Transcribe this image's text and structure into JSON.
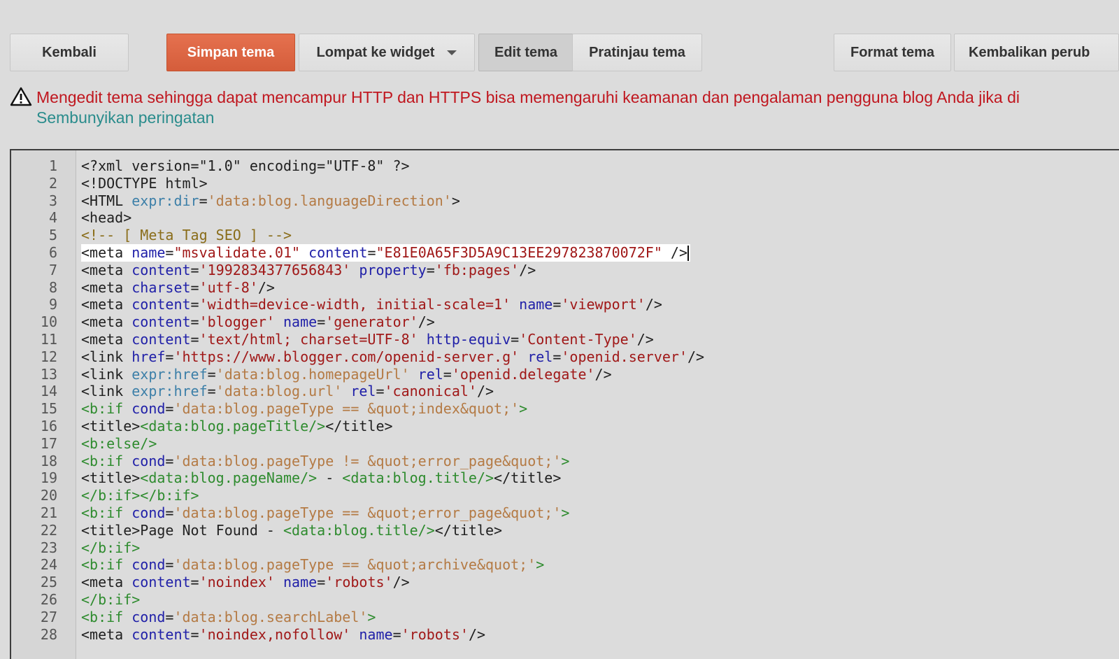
{
  "toolbar": {
    "back_label": "Kembali",
    "save_label": "Simpan tema",
    "jump_label": "Lompat ke widget",
    "edit_label": "Edit tema",
    "preview_label": "Pratinjau tema",
    "format_label": "Format tema",
    "revert_label": "Kembalikan perub"
  },
  "warning": {
    "text": "Mengedit tema sehingga dapat mencampur HTTP dan HTTPS bisa memengaruhi keamanan dan pengalaman pengguna blog Anda jika di",
    "hide_link": "Sembunyikan peringatan"
  },
  "colors": {
    "save_button": "#d55d3b",
    "warning_text": "#c0171f",
    "link": "#2a8c8c",
    "background": "#dcdcdc"
  },
  "editor": {
    "active_line": 6,
    "lines": [
      [
        [
          "tag",
          "<?xml version=\"1.0\" encoding=\"UTF-8\" ?>"
        ]
      ],
      [
        [
          "tag",
          "<!DOCTYPE html>"
        ]
      ],
      [
        [
          "tag",
          "<HTML "
        ],
        [
          "attrx",
          "expr:dir"
        ],
        [
          "tag",
          "="
        ],
        [
          "valx",
          "'data:blog.languageDirection'"
        ],
        [
          "tag",
          ">"
        ]
      ],
      [
        [
          "tag",
          "<head>"
        ]
      ],
      [
        [
          "comment",
          "<!-- [ Meta Tag SEO ] -->"
        ]
      ],
      [
        [
          "tag",
          "<meta "
        ],
        [
          "attr",
          "name"
        ],
        [
          "tag",
          "="
        ],
        [
          "val",
          "\"msvalidate.01\""
        ],
        [
          "tag",
          " "
        ],
        [
          "attr",
          "content"
        ],
        [
          "tag",
          "="
        ],
        [
          "val",
          "\"E81E0A65F3D5A9C13EE297823870072F\""
        ],
        [
          "tag",
          " />"
        ]
      ],
      [
        [
          "tag",
          "<meta "
        ],
        [
          "attr",
          "content"
        ],
        [
          "tag",
          "="
        ],
        [
          "val",
          "'1992834377656843'"
        ],
        [
          "tag",
          " "
        ],
        [
          "attr",
          "property"
        ],
        [
          "tag",
          "="
        ],
        [
          "val",
          "'fb:pages'"
        ],
        [
          "tag",
          "/>"
        ]
      ],
      [
        [
          "tag",
          "<meta "
        ],
        [
          "attr",
          "charset"
        ],
        [
          "tag",
          "="
        ],
        [
          "val",
          "'utf-8'"
        ],
        [
          "tag",
          "/>"
        ]
      ],
      [
        [
          "tag",
          "<meta "
        ],
        [
          "attr",
          "content"
        ],
        [
          "tag",
          "="
        ],
        [
          "val",
          "'width=device-width, initial-scale=1'"
        ],
        [
          "tag",
          " "
        ],
        [
          "attr",
          "name"
        ],
        [
          "tag",
          "="
        ],
        [
          "val",
          "'viewport'"
        ],
        [
          "tag",
          "/>"
        ]
      ],
      [
        [
          "tag",
          "<meta "
        ],
        [
          "attr",
          "content"
        ],
        [
          "tag",
          "="
        ],
        [
          "val",
          "'blogger'"
        ],
        [
          "tag",
          " "
        ],
        [
          "attr",
          "name"
        ],
        [
          "tag",
          "="
        ],
        [
          "val",
          "'generator'"
        ],
        [
          "tag",
          "/>"
        ]
      ],
      [
        [
          "tag",
          "<meta "
        ],
        [
          "attr",
          "content"
        ],
        [
          "tag",
          "="
        ],
        [
          "val",
          "'text/html; charset=UTF-8'"
        ],
        [
          "tag",
          " "
        ],
        [
          "attr",
          "http-equiv"
        ],
        [
          "tag",
          "="
        ],
        [
          "val",
          "'Content-Type'"
        ],
        [
          "tag",
          "/>"
        ]
      ],
      [
        [
          "tag",
          "<link "
        ],
        [
          "attr",
          "href"
        ],
        [
          "tag",
          "="
        ],
        [
          "val",
          "'https://www.blogger.com/openid-server.g'"
        ],
        [
          "tag",
          " "
        ],
        [
          "attr",
          "rel"
        ],
        [
          "tag",
          "="
        ],
        [
          "val",
          "'openid.server'"
        ],
        [
          "tag",
          "/>"
        ]
      ],
      [
        [
          "tag",
          "<link "
        ],
        [
          "attrx",
          "expr:href"
        ],
        [
          "tag",
          "="
        ],
        [
          "valx",
          "'data:blog.homepageUrl'"
        ],
        [
          "tag",
          " "
        ],
        [
          "attr",
          "rel"
        ],
        [
          "tag",
          "="
        ],
        [
          "val",
          "'openid.delegate'"
        ],
        [
          "tag",
          "/>"
        ]
      ],
      [
        [
          "tag",
          "<link "
        ],
        [
          "attrx",
          "expr:href"
        ],
        [
          "tag",
          "="
        ],
        [
          "valx",
          "'data:blog.url'"
        ],
        [
          "tag",
          " "
        ],
        [
          "attr",
          "rel"
        ],
        [
          "tag",
          "="
        ],
        [
          "val",
          "'canonical'"
        ],
        [
          "tag",
          "/>"
        ]
      ],
      [
        [
          "btag",
          "<b:if "
        ],
        [
          "attr",
          "cond"
        ],
        [
          "tag",
          "="
        ],
        [
          "valx",
          "'data:blog.pageType == &quot;index&quot;'"
        ],
        [
          "btag",
          ">"
        ]
      ],
      [
        [
          "tag",
          "<title>"
        ],
        [
          "btag",
          "<data:blog.pageTitle/>"
        ],
        [
          "tag",
          "</title>"
        ]
      ],
      [
        [
          "btag",
          "<b:else/>"
        ]
      ],
      [
        [
          "btag",
          "<b:if "
        ],
        [
          "attr",
          "cond"
        ],
        [
          "tag",
          "="
        ],
        [
          "valx",
          "'data:blog.pageType != &quot;error_page&quot;'"
        ],
        [
          "btag",
          ">"
        ]
      ],
      [
        [
          "tag",
          "<title>"
        ],
        [
          "btag",
          "<data:blog.pageName/>"
        ],
        [
          "text",
          " - "
        ],
        [
          "btag",
          "<data:blog.title/>"
        ],
        [
          "tag",
          "</title>"
        ]
      ],
      [
        [
          "btag",
          "</b:if></b:if>"
        ]
      ],
      [
        [
          "btag",
          "<b:if "
        ],
        [
          "attr",
          "cond"
        ],
        [
          "tag",
          "="
        ],
        [
          "valx",
          "'data:blog.pageType == &quot;error_page&quot;'"
        ],
        [
          "btag",
          ">"
        ]
      ],
      [
        [
          "tag",
          "<title>"
        ],
        [
          "text",
          "Page Not Found - "
        ],
        [
          "btag",
          "<data:blog.title/>"
        ],
        [
          "tag",
          "</title>"
        ]
      ],
      [
        [
          "btag",
          "</b:if>"
        ]
      ],
      [
        [
          "btag",
          "<b:if "
        ],
        [
          "attr",
          "cond"
        ],
        [
          "tag",
          "="
        ],
        [
          "valx",
          "'data:blog.pageType == &quot;archive&quot;'"
        ],
        [
          "btag",
          ">"
        ]
      ],
      [
        [
          "tag",
          "<meta "
        ],
        [
          "attr",
          "content"
        ],
        [
          "tag",
          "="
        ],
        [
          "val",
          "'noindex'"
        ],
        [
          "tag",
          " "
        ],
        [
          "attr",
          "name"
        ],
        [
          "tag",
          "="
        ],
        [
          "val",
          "'robots'"
        ],
        [
          "tag",
          "/>"
        ]
      ],
      [
        [
          "btag",
          "</b:if>"
        ]
      ],
      [
        [
          "btag",
          "<b:if "
        ],
        [
          "attr",
          "cond"
        ],
        [
          "tag",
          "="
        ],
        [
          "valx",
          "'data:blog.searchLabel'"
        ],
        [
          "btag",
          ">"
        ]
      ],
      [
        [
          "tag",
          "<meta "
        ],
        [
          "attr",
          "content"
        ],
        [
          "tag",
          "="
        ],
        [
          "val",
          "'noindex,nofollow'"
        ],
        [
          "tag",
          " "
        ],
        [
          "attr",
          "name"
        ],
        [
          "tag",
          "="
        ],
        [
          "val",
          "'robots'"
        ],
        [
          "tag",
          "/>"
        ]
      ]
    ]
  }
}
